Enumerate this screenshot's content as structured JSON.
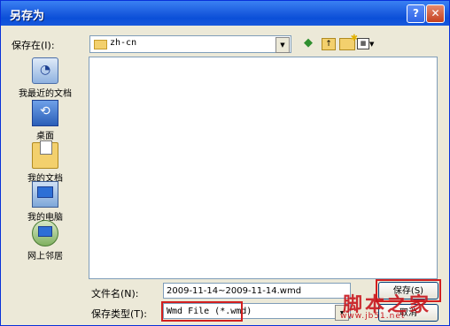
{
  "window": {
    "title": "另存为",
    "help_symbol": "?",
    "close_symbol": "✕"
  },
  "toolbar": {
    "save_in_label": "保存在(I):",
    "save_in_value": "zh-cn",
    "back_icon": "green-back-arrow",
    "up_icon": "folder-up",
    "new_folder_icon": "new-folder",
    "view_menu_icon": "view-menu"
  },
  "places": [
    {
      "label": "我最近的文档",
      "icon": "recent-documents"
    },
    {
      "label": "桌面",
      "icon": "desktop"
    },
    {
      "label": "我的文档",
      "icon": "my-documents"
    },
    {
      "label": "我的电脑",
      "icon": "my-computer"
    },
    {
      "label": "网上邻居",
      "icon": "network-places"
    }
  ],
  "form": {
    "filename_label": "文件名(N):",
    "filename_value": "2009-11-14~2009-11-14.wmd",
    "filetype_label": "保存类型(T):",
    "filetype_value": "Wmd File (*.wmd)"
  },
  "buttons": {
    "save": "保存(S)",
    "cancel": "取消"
  },
  "watermark": {
    "text": "脚本之家",
    "url": "www.jb51.net"
  },
  "colors": {
    "title_bar": "#1d5fe0",
    "highlight_box": "#d21f1f",
    "watermark": "#c8161d"
  }
}
